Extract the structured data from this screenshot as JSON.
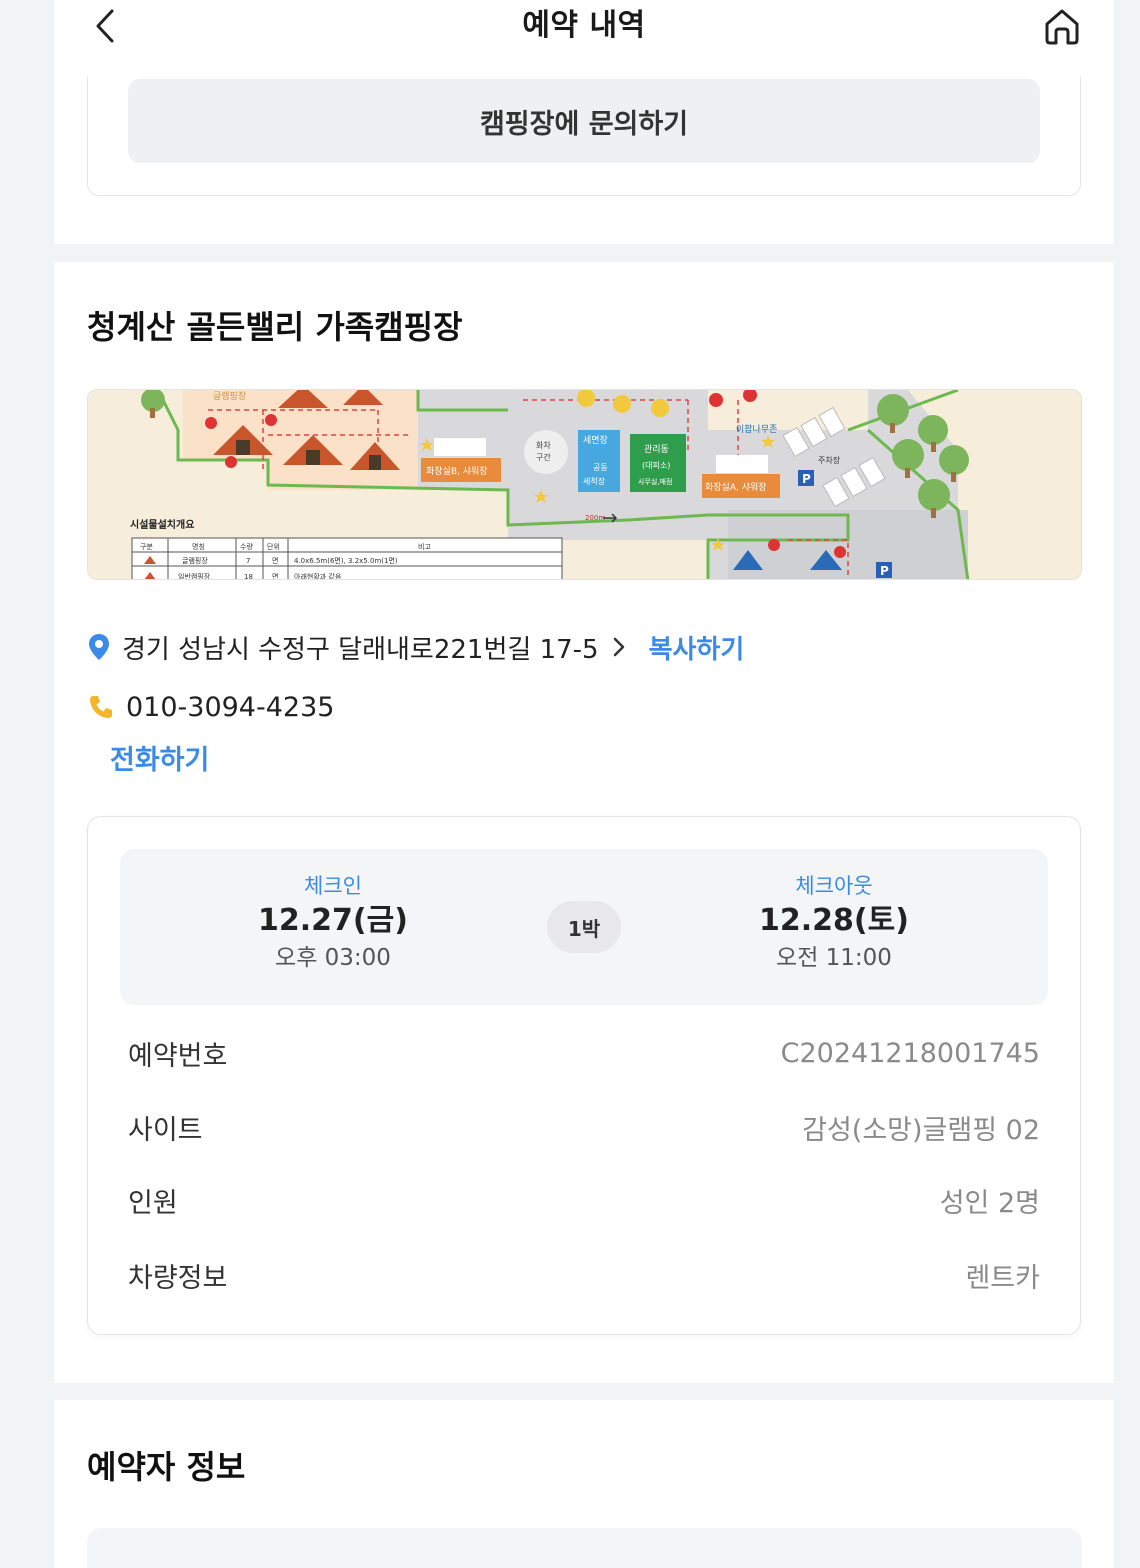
{
  "header": {
    "title": "예약 내역"
  },
  "inquiry": {
    "button_label": "캠핑장에 문의하기"
  },
  "campsite": {
    "name": "청계산 골든밸리 가족캠핑장",
    "address": "경기 성남시 수정구 달래내로221번길 17-5",
    "copy_label": "복사하기",
    "phone": "010-3094-4235",
    "call_label": "전화하기",
    "map_labels": {
      "glamping": "글램핑장",
      "restroom_b": "화장실B, 샤워장",
      "restroom_a": "화장실A, 샤워장",
      "wash": "세면장",
      "wash_sub": "공동",
      "wash_sub2": "세척장",
      "office": "관리동",
      "office_sub": "(대피소)",
      "office_sub2": "사무실,매점",
      "parking": "주차장",
      "zone": "화차",
      "zone2": "구간",
      "forest": "이팝나무존",
      "facility_title": "시설물설치개요",
      "table_headers": [
        "구분",
        "명칭",
        "수량",
        "단위",
        "비고"
      ],
      "table_row1": [
        "글램핑장",
        "7",
        "면",
        "4.0x6.5m(6면), 3.2x5.0m(1면)"
      ],
      "table_row2": [
        "일반캠핑장",
        "18",
        "면",
        "아래현황과 같음"
      ],
      "arrow_text": "200m"
    }
  },
  "reservation": {
    "checkin_label": "체크인",
    "checkin_date": "12.27(금)",
    "checkin_time": "오후 03:00",
    "nights": "1박",
    "checkout_label": "체크아웃",
    "checkout_date": "12.28(토)",
    "checkout_time": "오전 11:00",
    "rows": [
      {
        "label": "예약번호",
        "value": "C20241218001745"
      },
      {
        "label": "사이트",
        "value": "감성(소망)글램핑 02"
      },
      {
        "label": "인원",
        "value": "성인 2명"
      },
      {
        "label": "차량정보",
        "value": "렌트카"
      }
    ]
  },
  "booker": {
    "title": "예약자 정보"
  },
  "colors": {
    "accent": "#3b8ae8",
    "pin": "#3b8ae8",
    "phone_icon": "#f5b528"
  },
  "icons": {
    "back": "chevron-left-icon",
    "home": "home-icon",
    "pin": "location-pin-icon",
    "phone": "phone-icon",
    "chevron": "chevron-right-icon"
  }
}
